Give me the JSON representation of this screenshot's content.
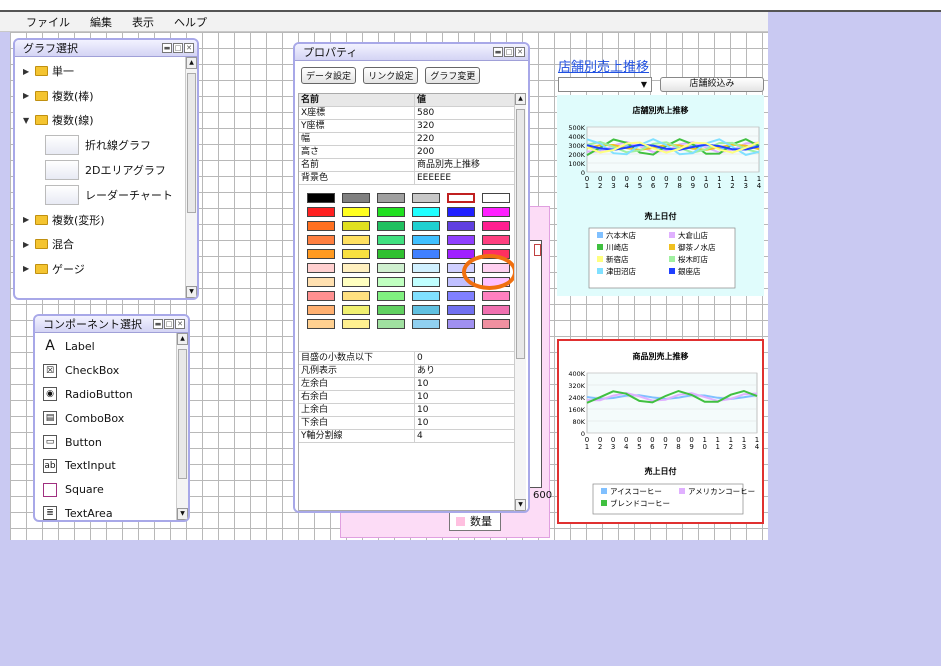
{
  "menu": [
    "ファイル",
    "編集",
    "表示",
    "ヘルプ"
  ],
  "graph_panel": {
    "title": "グラフ選択",
    "items": [
      {
        "label": "単一",
        "expanded": false
      },
      {
        "label": "複数(棒)",
        "expanded": false
      },
      {
        "label": "複数(線)",
        "expanded": true
      },
      {
        "label": "折れ線グラフ",
        "child": true
      },
      {
        "label": "2Dエリアグラフ",
        "child": true
      },
      {
        "label": "レーダーチャート",
        "child": true
      },
      {
        "label": "複数(変形)",
        "expanded": false
      },
      {
        "label": "混合",
        "expanded": false
      },
      {
        "label": "ゲージ",
        "expanded": false
      }
    ]
  },
  "component_panel": {
    "title": "コンポーネント選択",
    "items": [
      "Label",
      "CheckBox",
      "RadioButton",
      "ComboBox",
      "Button",
      "TextInput",
      "Square",
      "TextArea"
    ]
  },
  "property_panel": {
    "title": "プロパティ",
    "buttons": [
      "データ設定",
      "リンク設定",
      "グラフ変更"
    ],
    "header": {
      "name": "名前",
      "value": "値"
    },
    "rows_top": [
      [
        "X座標",
        "580"
      ],
      [
        "Y座標",
        "320"
      ],
      [
        "幅",
        "220"
      ],
      [
        "高さ",
        "200"
      ],
      [
        "名前",
        "商品別売上推移"
      ],
      [
        "背景色",
        "EEEEEE"
      ]
    ],
    "swatch_colors": [
      [
        "#000000",
        "#808080",
        "#a0a0a0",
        "#c8c8c8",
        "#ffffff",
        "#ffffff"
      ],
      [
        "#ff2020",
        "#ffff20",
        "#20e020",
        "#20ffff",
        "#2020ff",
        "#ff20ff"
      ],
      [
        "#ff7020",
        "#e0e020",
        "#20c060",
        "#20d0d0",
        "#6040e0",
        "#ff2090"
      ],
      [
        "#ff8040",
        "#ffe060",
        "#40e080",
        "#40c0ff",
        "#9040ff",
        "#ff4080"
      ],
      [
        "#ff9a20",
        "#f8e040",
        "#30c030",
        "#4080ff",
        "#a020ff",
        "#ff3060"
      ],
      [
        "#ffd0d0",
        "#fff0c0",
        "#d0f0d0",
        "#d0f0ff",
        "#d0d0ff",
        "#ffd0f0"
      ],
      [
        "#ffe0b0",
        "#ffffc0",
        "#c0ffc0",
        "#c0ffff",
        "#c0c0ff",
        "#ffc0ff"
      ],
      [
        "#ff9090",
        "#ffe080",
        "#80f080",
        "#80e0ff",
        "#8080ff",
        "#ff80c0"
      ],
      [
        "#ffb070",
        "#f0f070",
        "#60d060",
        "#60c0e0",
        "#7070f0",
        "#f070b0"
      ],
      [
        "#ffd090",
        "#fff090",
        "#a0e0a0",
        "#90d0f0",
        "#a090f0",
        "#f090a0"
      ]
    ],
    "rows_bottom": [
      [
        "目盛の小数点以下",
        "0"
      ],
      [
        "凡例表示",
        "あり"
      ],
      [
        "左余白",
        "10"
      ],
      [
        "右余白",
        "10"
      ],
      [
        "上余白",
        "10"
      ],
      [
        "下余白",
        "10"
      ],
      [
        "Y軸分割線",
        "4"
      ]
    ]
  },
  "pink_chart": {
    "axis_value": "600",
    "legend": "数量"
  },
  "store_panel": {
    "link_title": "店舗別売上推移",
    "filter_button": "店舗絞込み",
    "chart_title": "店舗別売上推移",
    "xlabel": "売上日付",
    "y_ticks": [
      "500K",
      "400K",
      "300K",
      "200K",
      "100K",
      "0"
    ],
    "x_ticks": [
      "0\n1",
      "0\n2",
      "0\n3",
      "0\n4",
      "0\n5",
      "0\n6",
      "0\n7",
      "0\n8",
      "0\n9",
      "1\n0",
      "1\n1",
      "1\n2",
      "1\n3",
      "1\n4"
    ],
    "legend": [
      {
        "label": "六本木店",
        "color": "#80c0ff"
      },
      {
        "label": "大倉山店",
        "color": "#e0b0ff"
      },
      {
        "label": "川崎店",
        "color": "#40c040"
      },
      {
        "label": "御茶ノ水店",
        "color": "#f0c020"
      },
      {
        "label": "新宿店",
        "color": "#ffff80"
      },
      {
        "label": "桜木町店",
        "color": "#a0f0a0"
      },
      {
        "label": "津田沼店",
        "color": "#80e0ff"
      },
      {
        "label": "銀座店",
        "color": "#2040ff"
      }
    ]
  },
  "product_panel": {
    "chart_title": "商品別売上推移",
    "xlabel": "売上日付",
    "y_ticks": [
      "400K",
      "320K",
      "240K",
      "160K",
      "80K",
      "0"
    ],
    "x_ticks": [
      "0\n1",
      "0\n2",
      "0\n3",
      "0\n4",
      "0\n5",
      "0\n6",
      "0\n7",
      "0\n8",
      "0\n9",
      "1\n0",
      "1\n1",
      "1\n2",
      "1\n3",
      "1\n4"
    ],
    "legend": [
      {
        "label": "アイスコーヒー",
        "color": "#80c0ff"
      },
      {
        "label": "アメリカンコーヒー",
        "color": "#e0b0ff"
      },
      {
        "label": "ブレンドコーヒー",
        "color": "#40c040"
      }
    ]
  }
}
